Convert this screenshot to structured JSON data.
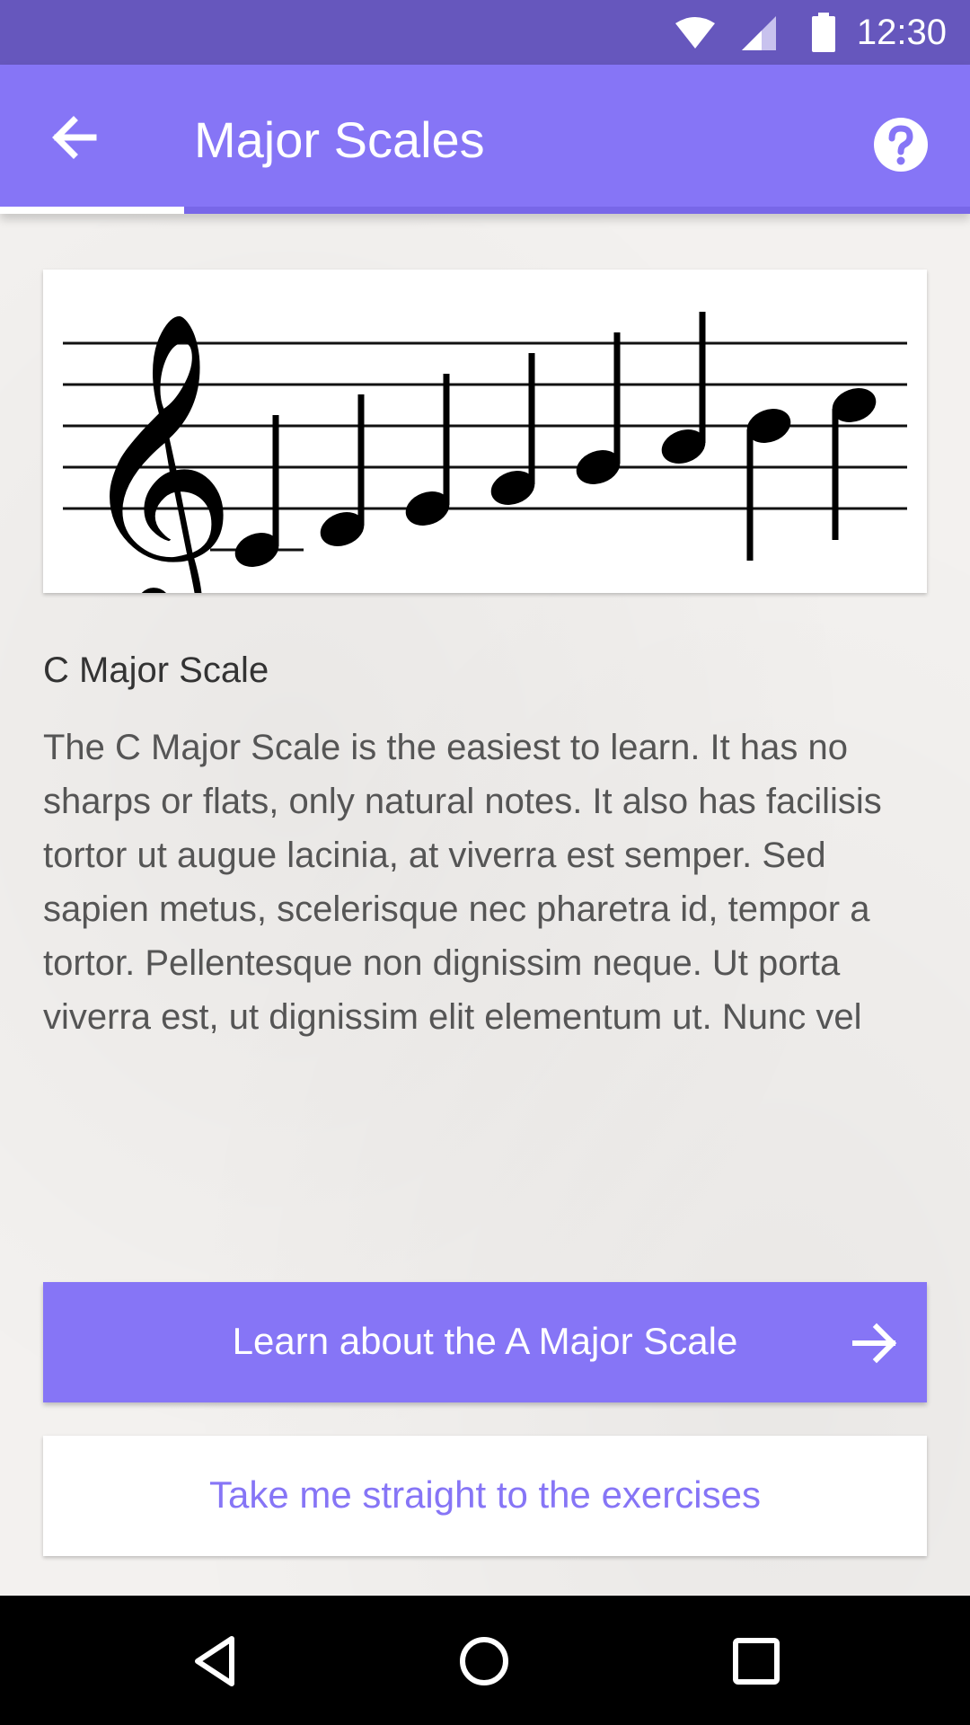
{
  "status_bar": {
    "time": "12:30",
    "icons": [
      "wifi-icon",
      "cellular-signal-icon",
      "battery-icon"
    ],
    "color": "#6657bd"
  },
  "app_bar": {
    "title": "Major Scales",
    "back_icon": "arrow-left-icon",
    "help_icon": "help-circle-icon",
    "color": "#8675f6",
    "progress": 0.19
  },
  "lesson": {
    "notation": {
      "clef": "treble",
      "notes": [
        "C4",
        "D4",
        "E4",
        "F4",
        "G4",
        "A4",
        "B4",
        "C5"
      ]
    },
    "heading": "C Major Scale",
    "body": "The C Major Scale is the easiest to learn. It has no sharps or flats, only natural notes. It also has facilisis tortor ut augue lacinia, at viverra est semper. Sed sapien metus, scelerisque nec pharetra id, tempor a tortor. Pellentesque non dignissim neque. Ut porta viverra est, ut dignissim elit elementum ut. Nunc vel"
  },
  "actions": {
    "primary_label": "Learn about the A Major Scale",
    "primary_icon": "arrow-right-icon",
    "secondary_label": "Take me straight to the exercises",
    "accent": "#8675f6"
  },
  "nav_bar": {
    "buttons": [
      "back-triangle-icon",
      "home-circle-icon",
      "recents-square-icon"
    ]
  }
}
